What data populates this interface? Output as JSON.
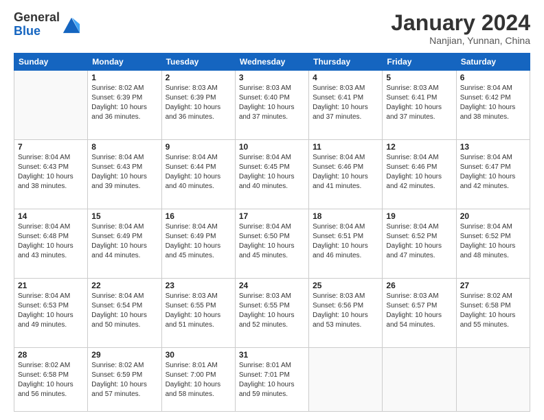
{
  "header": {
    "logo_general": "General",
    "logo_blue": "Blue",
    "month": "January 2024",
    "location": "Nanjian, Yunnan, China"
  },
  "weekdays": [
    "Sunday",
    "Monday",
    "Tuesday",
    "Wednesday",
    "Thursday",
    "Friday",
    "Saturday"
  ],
  "weeks": [
    [
      {
        "day": "",
        "info": ""
      },
      {
        "day": "1",
        "info": "Sunrise: 8:02 AM\nSunset: 6:39 PM\nDaylight: 10 hours\nand 36 minutes."
      },
      {
        "day": "2",
        "info": "Sunrise: 8:03 AM\nSunset: 6:39 PM\nDaylight: 10 hours\nand 36 minutes."
      },
      {
        "day": "3",
        "info": "Sunrise: 8:03 AM\nSunset: 6:40 PM\nDaylight: 10 hours\nand 37 minutes."
      },
      {
        "day": "4",
        "info": "Sunrise: 8:03 AM\nSunset: 6:41 PM\nDaylight: 10 hours\nand 37 minutes."
      },
      {
        "day": "5",
        "info": "Sunrise: 8:03 AM\nSunset: 6:41 PM\nDaylight: 10 hours\nand 37 minutes."
      },
      {
        "day": "6",
        "info": "Sunrise: 8:04 AM\nSunset: 6:42 PM\nDaylight: 10 hours\nand 38 minutes."
      }
    ],
    [
      {
        "day": "7",
        "info": "Sunrise: 8:04 AM\nSunset: 6:43 PM\nDaylight: 10 hours\nand 38 minutes."
      },
      {
        "day": "8",
        "info": "Sunrise: 8:04 AM\nSunset: 6:43 PM\nDaylight: 10 hours\nand 39 minutes."
      },
      {
        "day": "9",
        "info": "Sunrise: 8:04 AM\nSunset: 6:44 PM\nDaylight: 10 hours\nand 40 minutes."
      },
      {
        "day": "10",
        "info": "Sunrise: 8:04 AM\nSunset: 6:45 PM\nDaylight: 10 hours\nand 40 minutes."
      },
      {
        "day": "11",
        "info": "Sunrise: 8:04 AM\nSunset: 6:46 PM\nDaylight: 10 hours\nand 41 minutes."
      },
      {
        "day": "12",
        "info": "Sunrise: 8:04 AM\nSunset: 6:46 PM\nDaylight: 10 hours\nand 42 minutes."
      },
      {
        "day": "13",
        "info": "Sunrise: 8:04 AM\nSunset: 6:47 PM\nDaylight: 10 hours\nand 42 minutes."
      }
    ],
    [
      {
        "day": "14",
        "info": "Sunrise: 8:04 AM\nSunset: 6:48 PM\nDaylight: 10 hours\nand 43 minutes."
      },
      {
        "day": "15",
        "info": "Sunrise: 8:04 AM\nSunset: 6:49 PM\nDaylight: 10 hours\nand 44 minutes."
      },
      {
        "day": "16",
        "info": "Sunrise: 8:04 AM\nSunset: 6:49 PM\nDaylight: 10 hours\nand 45 minutes."
      },
      {
        "day": "17",
        "info": "Sunrise: 8:04 AM\nSunset: 6:50 PM\nDaylight: 10 hours\nand 45 minutes."
      },
      {
        "day": "18",
        "info": "Sunrise: 8:04 AM\nSunset: 6:51 PM\nDaylight: 10 hours\nand 46 minutes."
      },
      {
        "day": "19",
        "info": "Sunrise: 8:04 AM\nSunset: 6:52 PM\nDaylight: 10 hours\nand 47 minutes."
      },
      {
        "day": "20",
        "info": "Sunrise: 8:04 AM\nSunset: 6:52 PM\nDaylight: 10 hours\nand 48 minutes."
      }
    ],
    [
      {
        "day": "21",
        "info": "Sunrise: 8:04 AM\nSunset: 6:53 PM\nDaylight: 10 hours\nand 49 minutes."
      },
      {
        "day": "22",
        "info": "Sunrise: 8:04 AM\nSunset: 6:54 PM\nDaylight: 10 hours\nand 50 minutes."
      },
      {
        "day": "23",
        "info": "Sunrise: 8:03 AM\nSunset: 6:55 PM\nDaylight: 10 hours\nand 51 minutes."
      },
      {
        "day": "24",
        "info": "Sunrise: 8:03 AM\nSunset: 6:55 PM\nDaylight: 10 hours\nand 52 minutes."
      },
      {
        "day": "25",
        "info": "Sunrise: 8:03 AM\nSunset: 6:56 PM\nDaylight: 10 hours\nand 53 minutes."
      },
      {
        "day": "26",
        "info": "Sunrise: 8:03 AM\nSunset: 6:57 PM\nDaylight: 10 hours\nand 54 minutes."
      },
      {
        "day": "27",
        "info": "Sunrise: 8:02 AM\nSunset: 6:58 PM\nDaylight: 10 hours\nand 55 minutes."
      }
    ],
    [
      {
        "day": "28",
        "info": "Sunrise: 8:02 AM\nSunset: 6:58 PM\nDaylight: 10 hours\nand 56 minutes."
      },
      {
        "day": "29",
        "info": "Sunrise: 8:02 AM\nSunset: 6:59 PM\nDaylight: 10 hours\nand 57 minutes."
      },
      {
        "day": "30",
        "info": "Sunrise: 8:01 AM\nSunset: 7:00 PM\nDaylight: 10 hours\nand 58 minutes."
      },
      {
        "day": "31",
        "info": "Sunrise: 8:01 AM\nSunset: 7:01 PM\nDaylight: 10 hours\nand 59 minutes."
      },
      {
        "day": "",
        "info": ""
      },
      {
        "day": "",
        "info": ""
      },
      {
        "day": "",
        "info": ""
      }
    ]
  ]
}
